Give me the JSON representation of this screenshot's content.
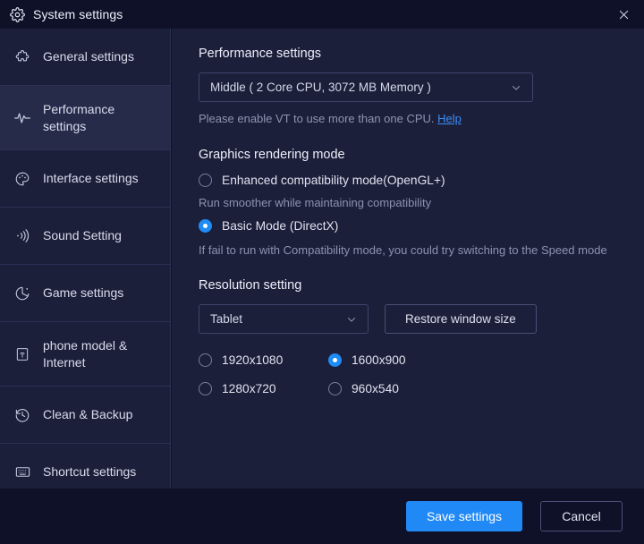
{
  "window": {
    "title": "System settings",
    "title_icon": "gear-icon",
    "close_icon": "close-icon"
  },
  "sidebar": {
    "items": [
      {
        "label": "General settings",
        "icon": "puzzle-icon",
        "selected": false
      },
      {
        "label": "Performance settings",
        "icon": "pulse-icon",
        "selected": true
      },
      {
        "label": "Interface settings",
        "icon": "palette-icon",
        "selected": false
      },
      {
        "label": "Sound Setting",
        "icon": "speaker-icon",
        "selected": false
      },
      {
        "label": "Game settings",
        "icon": "gamepad-icon",
        "selected": false
      },
      {
        "label": "phone model & Internet",
        "icon": "device-wifi-icon",
        "selected": false
      },
      {
        "label": "Clean & Backup",
        "icon": "history-icon",
        "selected": false
      },
      {
        "label": "Shortcut settings",
        "icon": "keyboard-icon",
        "selected": false
      }
    ]
  },
  "main": {
    "performance": {
      "title": "Performance settings",
      "select_value": "Middle ( 2 Core CPU, 3072 MB Memory )",
      "chevron_icon": "chevron-down-icon",
      "hint_text": "Please enable VT to use more than one CPU.",
      "hint_link": "Help"
    },
    "graphics": {
      "title": "Graphics rendering mode",
      "options": [
        {
          "label": "Enhanced compatibility mode(OpenGL+)",
          "selected": false,
          "description": "Run smoother while maintaining compatibility"
        },
        {
          "label": "Basic Mode (DirectX)",
          "selected": true,
          "description": " If fail to run with Compatibility mode, you could try switching to the Speed mode"
        }
      ]
    },
    "resolution": {
      "title": "Resolution setting",
      "select_value": "Tablet",
      "chevron_icon": "chevron-down-icon",
      "restore_button": "Restore window size",
      "options": [
        {
          "label": "1920x1080",
          "selected": false
        },
        {
          "label": "1600x900",
          "selected": true
        },
        {
          "label": "1280x720",
          "selected": false
        },
        {
          "label": "960x540",
          "selected": false
        }
      ]
    }
  },
  "footer": {
    "save_label": "Save settings",
    "cancel_label": "Cancel"
  },
  "colors": {
    "accent": "#2089f5",
    "link": "#3b8ef5",
    "panel": "#1b1f3a",
    "chrome": "#0e1128",
    "selected_row": "#262b4a"
  }
}
